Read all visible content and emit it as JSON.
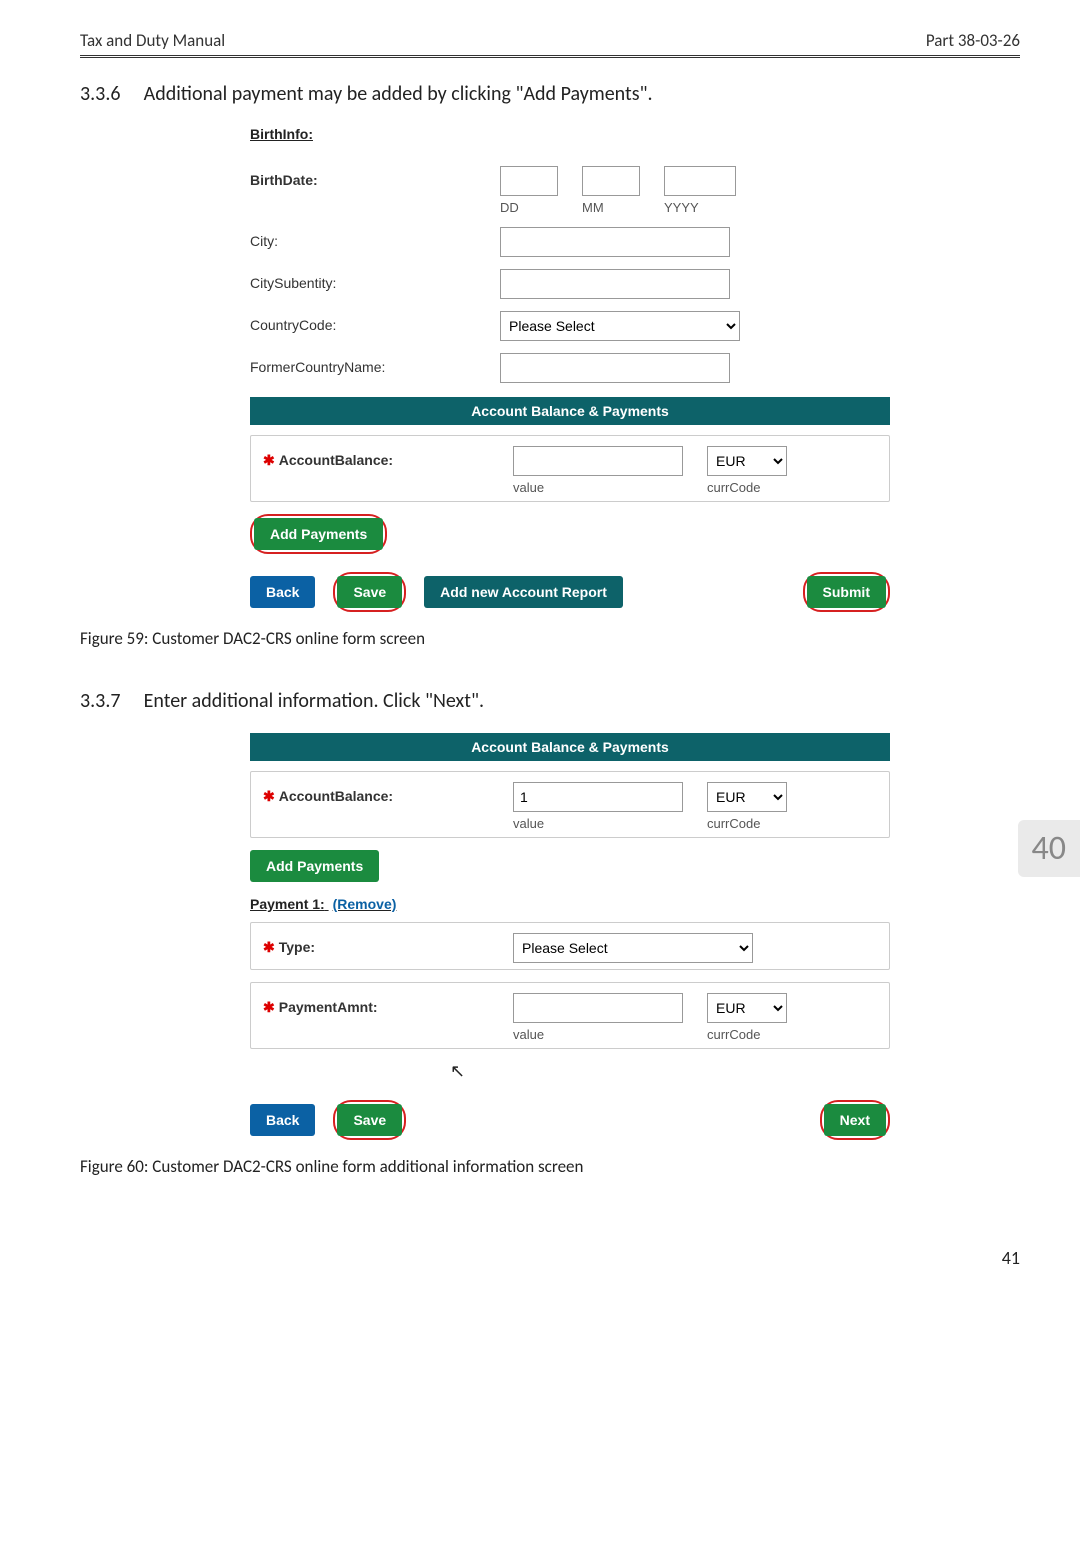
{
  "header": {
    "left": "Tax and Duty Manual",
    "right": "Part 38-03-26"
  },
  "sections": {
    "s336": {
      "num": "3.3.6",
      "title": "Additional payment may be added by clicking \"Add Payments\"."
    },
    "s337": {
      "num": "3.3.7",
      "title": "Enter additional information. Click \"Next\"."
    }
  },
  "fig59": {
    "birthinfo_heading": "BirthInfo:",
    "labels": {
      "birthdate": "BirthDate:",
      "dd": "DD",
      "mm": "MM",
      "yyyy": "YYYY",
      "city": "City:",
      "city_sub": "CitySubentity:",
      "country_code": "CountryCode:",
      "former_country": "FormerCountryName:"
    },
    "country_placeholder": "Please Select",
    "section_banner": "Account Balance & Payments",
    "account_balance_label": "AccountBalance:",
    "value_sub": "value",
    "currcode_sub": "currCode",
    "currency_options": [
      "EUR"
    ],
    "buttons": {
      "add_payments": "Add Payments",
      "back": "Back",
      "save": "Save",
      "add_new_account": "Add new Account Report",
      "submit": "Submit"
    },
    "caption": "Figure 59: Customer DAC2-CRS online form screen"
  },
  "fig60": {
    "section_banner": "Account Balance & Payments",
    "account_balance_label": "AccountBalance:",
    "account_balance_value": "1",
    "value_sub": "value",
    "currcode_sub": "currCode",
    "currency_options": [
      "EUR"
    ],
    "add_payments": "Add Payments",
    "payment_heading": "Payment 1:",
    "remove_text": "(Remove)",
    "type_label": "Type:",
    "type_placeholder": "Please Select",
    "payment_amnt_label": "PaymentAmnt:",
    "buttons": {
      "back": "Back",
      "save": "Save",
      "next": "Next"
    },
    "caption": "Figure 60: Customer DAC2-CRS online form additional information screen"
  },
  "side_badge": "40",
  "footer_page": "41"
}
